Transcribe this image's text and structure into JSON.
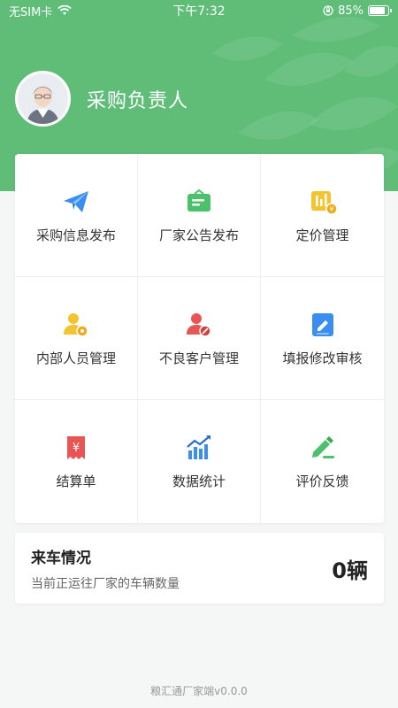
{
  "status_bar": {
    "carrier": "无SIM卡",
    "time": "下午7:32",
    "battery": "85%",
    "battery_level": 0.85
  },
  "profile": {
    "role_title": "采购负责人"
  },
  "colors": {
    "header": "#5fbd78",
    "blue": "#3a8ef0",
    "green": "#4cc06a",
    "yellow": "#f4c430",
    "red": "#e85555"
  },
  "menu": [
    {
      "label": "采购信息发布",
      "icon": "paper-plane-icon"
    },
    {
      "label": "厂家公告发布",
      "icon": "notice-board-icon"
    },
    {
      "label": "定价管理",
      "icon": "price-chart-icon"
    },
    {
      "label": "内部人员管理",
      "icon": "staff-settings-icon"
    },
    {
      "label": "不良客户管理",
      "icon": "user-block-icon"
    },
    {
      "label": "填报修改审核",
      "icon": "edit-document-icon"
    },
    {
      "label": "结算单",
      "icon": "receipt-yuan-icon"
    },
    {
      "label": "数据统计",
      "icon": "bar-chart-trend-icon"
    },
    {
      "label": "评价反馈",
      "icon": "pencil-feedback-icon"
    }
  ],
  "arrival": {
    "title": "来车情况",
    "subtitle": "当前正运往厂家的车辆数量",
    "count": "0辆"
  },
  "footer": {
    "version": "粮汇通厂家端v0.0.0"
  }
}
